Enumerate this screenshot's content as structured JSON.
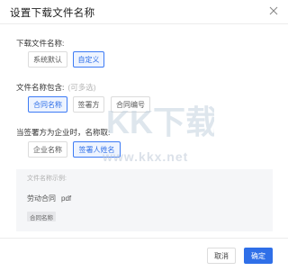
{
  "dialog": {
    "title": "设置下载文件名称",
    "close_icon": "close-icon"
  },
  "download_name": {
    "label": "下载文件名称:",
    "options": [
      {
        "label": "系统默认",
        "selected": false
      },
      {
        "label": "自定义",
        "selected": true
      }
    ]
  },
  "file_name_contains": {
    "label": "文件名称包含:",
    "hint": "(可多选)",
    "options": [
      {
        "label": "合同名称",
        "selected": true
      },
      {
        "label": "签署方",
        "selected": false
      },
      {
        "label": "合同编号",
        "selected": false
      }
    ]
  },
  "signer_is_company": {
    "label": "当签署方为企业时，名称取:",
    "options": [
      {
        "label": "企业名称",
        "selected": false
      },
      {
        "label": "签署人姓名",
        "selected": true
      }
    ]
  },
  "preview": {
    "title": "文件名称示例:",
    "file_name": "劳动合同",
    "extension": "pdf",
    "tag": "合同名称"
  },
  "footer": {
    "cancel_label": "取消",
    "confirm_label": "确定"
  },
  "watermark": {
    "text": "KK下载",
    "url": "www.kkx.net"
  },
  "colors": {
    "accent": "#2f6fe8",
    "accent_bg": "#eef4ff",
    "preview_bg": "#f5f6f8"
  }
}
